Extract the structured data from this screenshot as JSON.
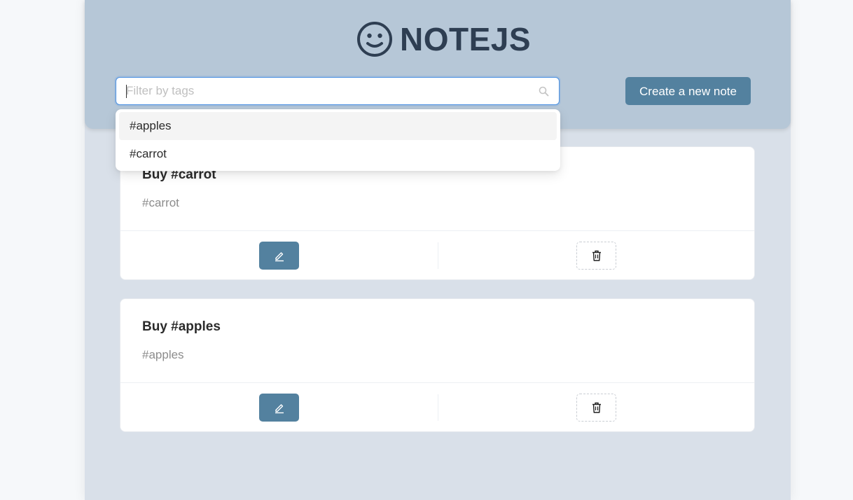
{
  "app": {
    "title": "NOTEJS",
    "brand_icon": "smiley-icon"
  },
  "search": {
    "placeholder": "Filter by tags",
    "value": "",
    "icon": "search-icon"
  },
  "create_button": {
    "label": "Create a new note"
  },
  "tag_dropdown": {
    "options": [
      {
        "label": "#apples",
        "highlighted": true
      },
      {
        "label": "#carrot",
        "highlighted": false
      }
    ]
  },
  "notes": [
    {
      "title": "Buy #carrot",
      "tags": "#carrot",
      "edit_icon": "pencil-icon",
      "delete_icon": "trash-icon"
    },
    {
      "title": "Buy #apples",
      "tags": "#apples",
      "edit_icon": "pencil-icon",
      "delete_icon": "trash-icon"
    }
  ],
  "colors": {
    "page_bg": "#f6f8fa",
    "app_bg": "#d9e0e9",
    "header_bg": "#b6c7d7",
    "brand_text": "#2e3e52",
    "primary": "#53819f",
    "focus_border": "#4a90e2"
  }
}
